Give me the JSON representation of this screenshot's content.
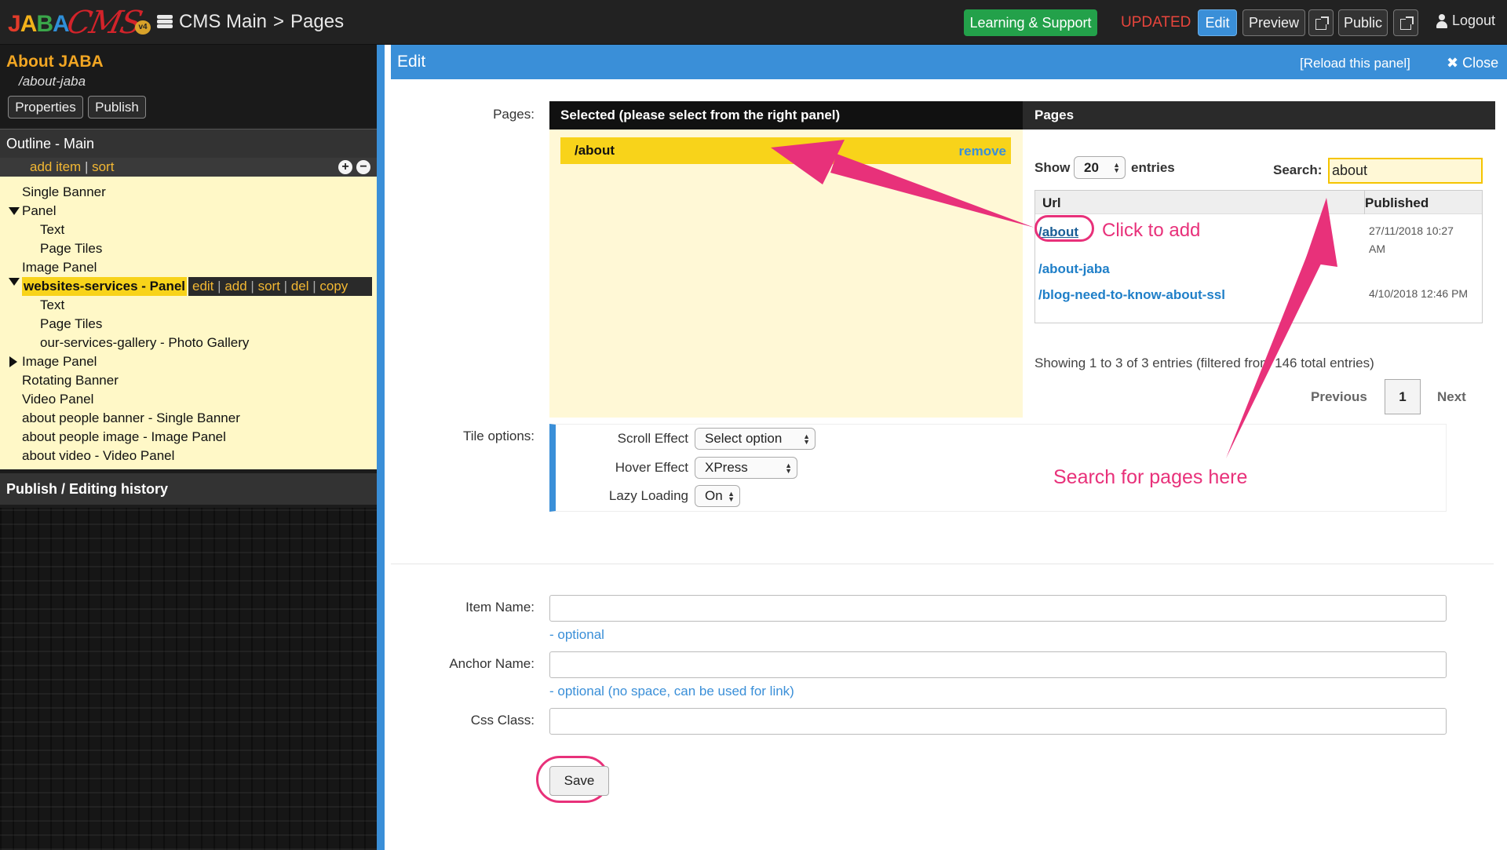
{
  "topbar": {
    "logo": {
      "jaba": [
        "J",
        "A",
        "B",
        "A"
      ],
      "cms": "CMS",
      "version": "v4"
    },
    "breadcrumb": {
      "root": "CMS Main",
      "sep": ">",
      "current": "Pages"
    },
    "learning_label": "Learning & Support",
    "status": "UPDATED",
    "edit_label": "Edit",
    "preview_label": "Preview",
    "public_label": "Public",
    "logout_label": "Logout"
  },
  "sidebar": {
    "page_title": "About JABA",
    "page_url": "/about-jaba",
    "properties_label": "Properties",
    "publish_label": "Publish",
    "outline_title": "Outline - Main",
    "outline_actions": {
      "add": "add item",
      "sep": "|",
      "sort": "sort",
      "plus": "+",
      "minus": "−"
    },
    "tree": [
      {
        "label": "Single Banner",
        "indent": 0,
        "toggle": "none"
      },
      {
        "label": "Panel",
        "indent": 0,
        "toggle": "open"
      },
      {
        "label": "Text",
        "indent": 1,
        "toggle": "none"
      },
      {
        "label": "Page Tiles",
        "indent": 1,
        "toggle": "none"
      },
      {
        "label": "Image Panel",
        "indent": 0,
        "toggle": "none"
      },
      {
        "label": "websites-services - Panel",
        "indent": 0,
        "toggle": "open",
        "selected": true
      },
      {
        "label": "Text",
        "indent": 1,
        "toggle": "none"
      },
      {
        "label": "Page Tiles",
        "indent": 1,
        "toggle": "none"
      },
      {
        "label": "our-services-gallery - Photo Gallery",
        "indent": 1,
        "toggle": "none"
      },
      {
        "label": "Image Panel",
        "indent": 0,
        "toggle": "none"
      },
      {
        "label": "Rotating Banner",
        "indent": 0,
        "toggle": "closed"
      },
      {
        "label": "Video Panel",
        "indent": 0,
        "toggle": "none"
      },
      {
        "label": "about people banner - Single Banner",
        "indent": 0,
        "toggle": "none"
      },
      {
        "label": "about people image - Image Panel",
        "indent": 0,
        "toggle": "none"
      },
      {
        "label": "about video - Video Panel",
        "indent": 0,
        "toggle": "none"
      }
    ],
    "node_actions": [
      "edit",
      "add",
      "sort",
      "del",
      "copy"
    ],
    "history_title": "Publish / Editing history"
  },
  "edit": {
    "title": "Edit",
    "reload_label": "[Reload this panel]",
    "close_label": "Close",
    "pages_label": "Pages:",
    "selected_header": "Selected (please select from the right panel)",
    "selected_items": [
      {
        "url": "/about",
        "remove_label": "remove"
      }
    ],
    "pages_header": "Pages",
    "show_label": "Show",
    "entries_value": "20",
    "entries_label": "entries",
    "search_label": "Search:",
    "search_value": "about",
    "table_headers": {
      "url": "Url",
      "published": "Published"
    },
    "rows": [
      {
        "url": "/about",
        "published": "27/11/2018 10:27 AM"
      },
      {
        "url": "/about-jaba",
        "published": ""
      },
      {
        "url": "/blog-need-to-know-about-ssl",
        "published": "4/10/2018 12:46 PM"
      }
    ],
    "showing_text": "Showing 1 to 3 of 3 entries (filtered from 146 total entries)",
    "pagination": {
      "previous": "Previous",
      "current": "1",
      "next": "Next"
    },
    "tile_label": "Tile options:",
    "tile_options": [
      {
        "label": "Scroll Effect",
        "value": "Select option"
      },
      {
        "label": "Hover Effect",
        "value": "XPress"
      },
      {
        "label": "Lazy Loading",
        "value": "On"
      }
    ],
    "annotations": {
      "click_to_add": "Click to add",
      "search_here": "Search for pages here"
    },
    "annotation_color": "#e8317a",
    "fields": [
      {
        "label": "Item Name:",
        "value": "",
        "hint": "- optional"
      },
      {
        "label": "Anchor Name:",
        "value": "",
        "hint": "- optional (no space, can be used for link)"
      },
      {
        "label": "Css Class:",
        "value": "",
        "hint": ""
      }
    ],
    "save_label": "Save"
  },
  "colors": {
    "accent_blue": "#3a8fd8",
    "highlight_yellow": "#f8d31a",
    "tree_bg": "#fff8c7",
    "green": "#23a14a",
    "status_red": "#e8453c"
  }
}
